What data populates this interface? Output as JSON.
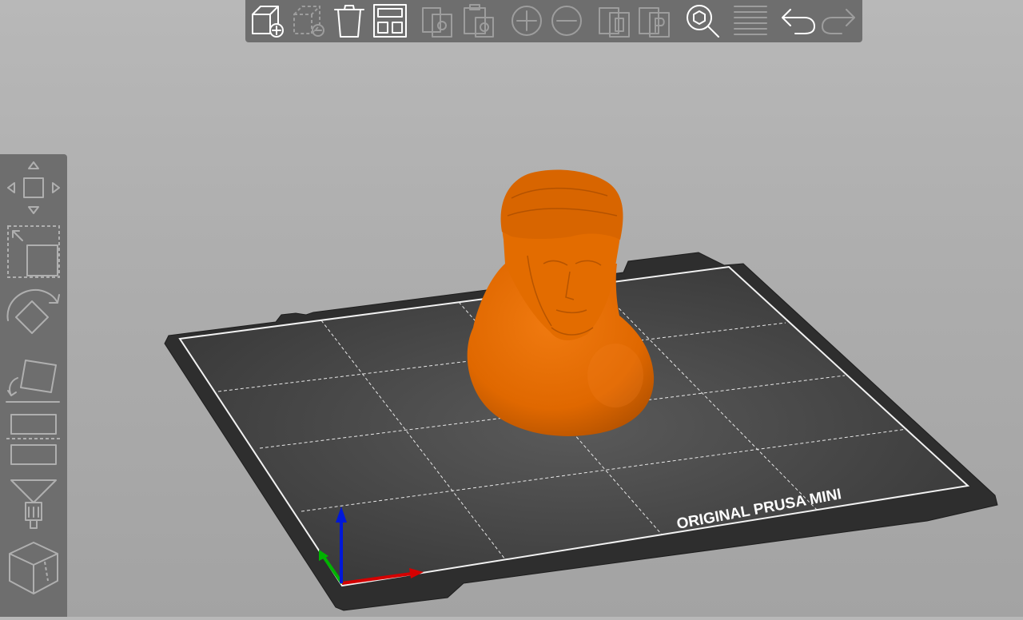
{
  "app": "PrusaSlicer",
  "printer": {
    "bed_label": "ORIGINAL PRUSA MINI"
  },
  "model": {
    "kind": "bust",
    "color": "#e86e00"
  },
  "colors": {
    "background_top": "#b8b8b8",
    "toolbar": "#6e6e6e",
    "bed_plate": "#2f2f2f",
    "bed_surface": "#474747",
    "axis_x": "#d40000",
    "axis_y": "#00b400",
    "axis_z": "#0018d8"
  },
  "top_toolbar": {
    "buttons": [
      {
        "name": "add-button",
        "icon": "add-icon",
        "enabled": true
      },
      {
        "name": "delete-button",
        "icon": "delete-icon",
        "enabled": false
      },
      {
        "name": "delete-all-button",
        "icon": "delete-all-icon",
        "enabled": true
      },
      {
        "name": "arrange-button",
        "icon": "arrange-icon",
        "enabled": true
      },
      {
        "name": "copy-button",
        "icon": "copy-icon",
        "enabled": false
      },
      {
        "name": "paste-button",
        "icon": "paste-icon",
        "enabled": false
      },
      {
        "name": "add-instance-button",
        "icon": "add-instance-icon",
        "enabled": false
      },
      {
        "name": "remove-instance-button",
        "icon": "remove-instance-icon",
        "enabled": false
      },
      {
        "name": "split-objects-button",
        "icon": "split-objects-icon",
        "enabled": false
      },
      {
        "name": "split-parts-button",
        "icon": "split-parts-icon",
        "enabled": false
      },
      {
        "name": "search-button",
        "icon": "search-icon",
        "enabled": true
      },
      {
        "name": "layers-button",
        "icon": "layers-icon",
        "enabled": false
      },
      {
        "name": "undo-button",
        "icon": "undo-icon",
        "enabled": true
      },
      {
        "name": "redo-button",
        "icon": "redo-icon",
        "enabled": false
      }
    ]
  },
  "left_toolbar": {
    "tools": [
      {
        "name": "move-tool",
        "icon": "move-icon"
      },
      {
        "name": "scale-tool",
        "icon": "scale-icon"
      },
      {
        "name": "rotate-tool",
        "icon": "rotate-icon"
      },
      {
        "name": "place-on-face-tool",
        "icon": "place-on-face-icon"
      },
      {
        "name": "cut-tool",
        "icon": "cut-icon"
      },
      {
        "name": "paint-supports-tool",
        "icon": "paint-supports-icon"
      },
      {
        "name": "seam-painting-tool",
        "icon": "seam-painting-icon"
      }
    ]
  }
}
